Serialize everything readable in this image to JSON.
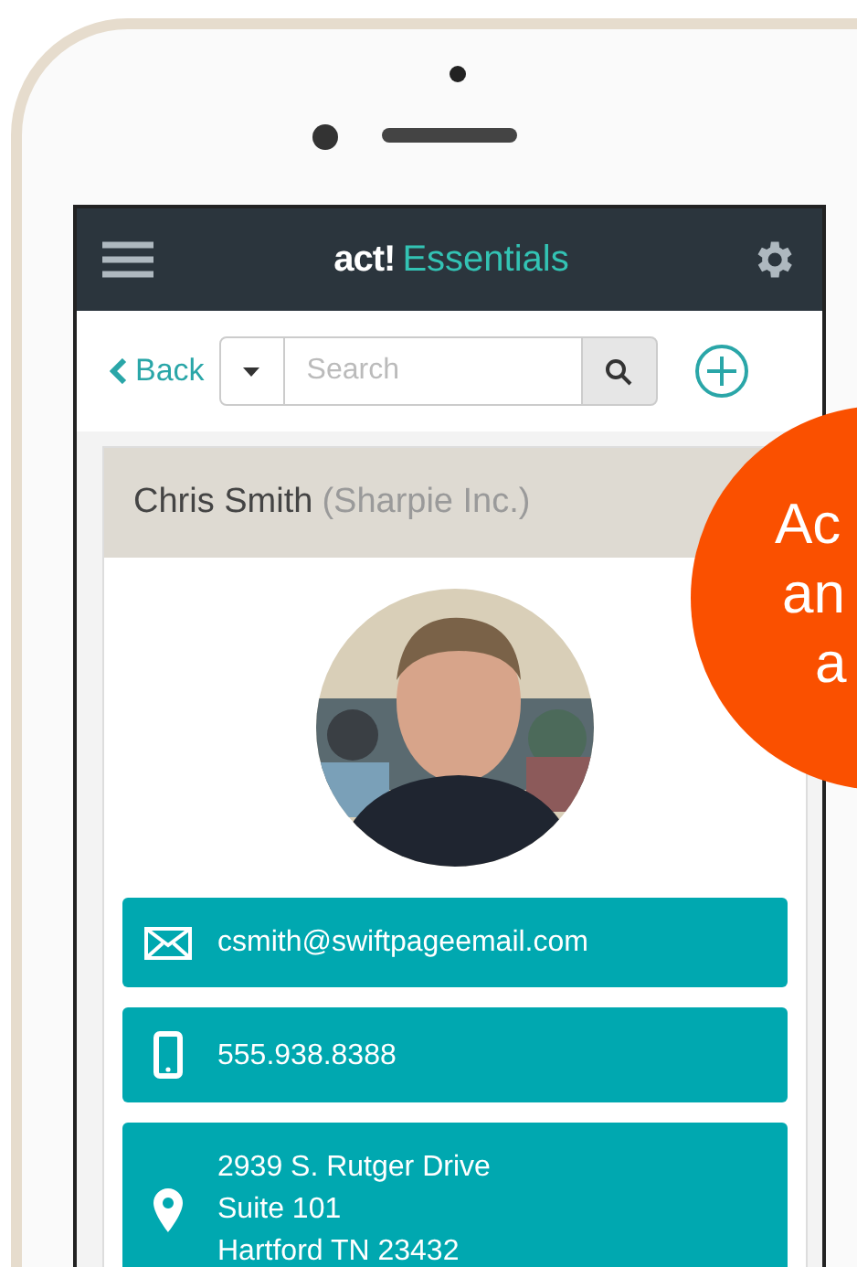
{
  "header": {
    "logo_bold": "act!",
    "logo_text": "Essentials"
  },
  "toolbar": {
    "back": "Back",
    "search": {
      "placeholder": "Search"
    }
  },
  "contact": {
    "name": "Chris Smith",
    "company": "(Sharpie Inc.)",
    "details": [
      {
        "kind": "email",
        "lines": [
          "csmith@swiftpageemail.com"
        ]
      },
      {
        "kind": "phone",
        "lines": [
          "555.938.8388"
        ]
      },
      {
        "kind": "address",
        "lines": [
          "2939 S. Rutger Drive",
          "Suite 101",
          "Hartford TN 23432"
        ]
      }
    ]
  },
  "callout": {
    "lines": [
      "Ac",
      "an",
      "a"
    ]
  }
}
